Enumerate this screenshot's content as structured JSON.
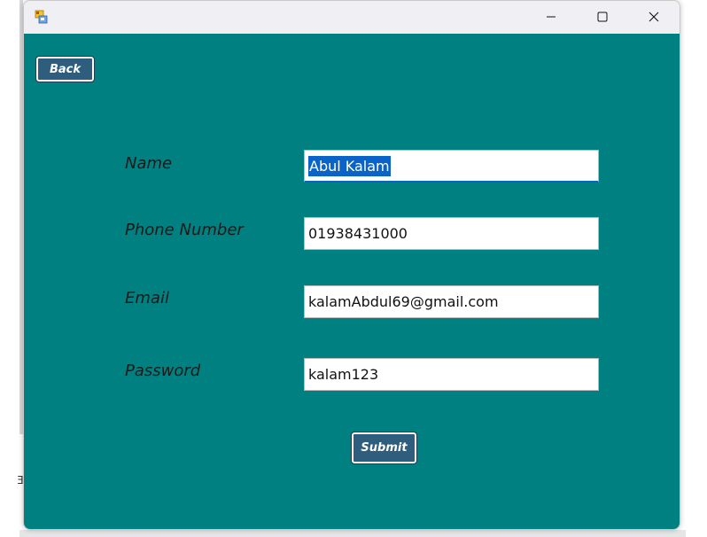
{
  "window": {
    "icon": "windows-form-icon",
    "controls": {
      "minimize": "minimize-icon",
      "maximize": "maximize-icon",
      "close": "close-icon"
    }
  },
  "form": {
    "back_label": "Back",
    "submit_label": "Submit",
    "background_color": "#008080",
    "button_color": "#2e5d7d",
    "fields": {
      "name": {
        "label": "Name",
        "value": "Abul Kalam",
        "selected": true
      },
      "phone": {
        "label": "Phone Number",
        "value": "01938431000"
      },
      "email": {
        "label": "Email",
        "value": "kalamAbdul69@gmail.com"
      },
      "password": {
        "label": "Password",
        "value": "kalam123"
      }
    }
  }
}
